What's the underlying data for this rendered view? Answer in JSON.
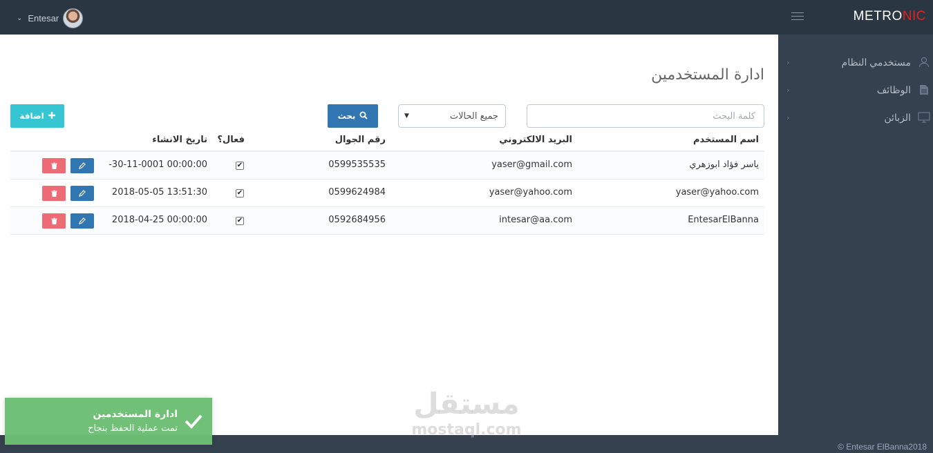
{
  "app": {
    "logo_main": "METRO",
    "logo_accent": "NIC"
  },
  "user": {
    "name": "Entesar"
  },
  "sidebar": {
    "items": [
      {
        "label": "مستخدمي النظام",
        "icon": "user-icon"
      },
      {
        "label": "الوظائف",
        "icon": "file-icon"
      },
      {
        "label": "الزبائن",
        "icon": "monitor-icon"
      }
    ]
  },
  "page": {
    "title": "ادارة المستخدمين"
  },
  "search": {
    "placeholder": "كلمة البحث",
    "status_selected": "جميع الحالات",
    "search_button": "بحث",
    "add_button": "اضافة"
  },
  "table": {
    "headers": {
      "username": "اسم المستخدم",
      "email": "البريد الالكتروني",
      "mobile": "رقم الجوال",
      "active": "فعال؟",
      "created": "تاريخ الانشاء"
    },
    "rows": [
      {
        "username": "ياسر فؤاد ابوزهري",
        "email": "yaser@gmail.com",
        "mobile": "0599535535",
        "active": true,
        "created": "-30-11-0001 00:00:00"
      },
      {
        "username": "yaser@yahoo.com",
        "email": "yaser@yahoo.com",
        "mobile": "0599624984",
        "active": true,
        "created": "2018-05-05 13:51:30"
      },
      {
        "username": "EntesarElBanna",
        "email": "intesar@aa.com",
        "mobile": "0592684956",
        "active": true,
        "created": "2018-04-25 00:00:00"
      }
    ]
  },
  "toast": {
    "title": "ادارة المستخدمين",
    "message": "تمت عملية الحفظ بنجاح"
  },
  "footer": {
    "copyright": "© Entesar ElBanna2018"
  },
  "watermark": {
    "arabic": "مستقل",
    "latin": "mostaql.com"
  }
}
